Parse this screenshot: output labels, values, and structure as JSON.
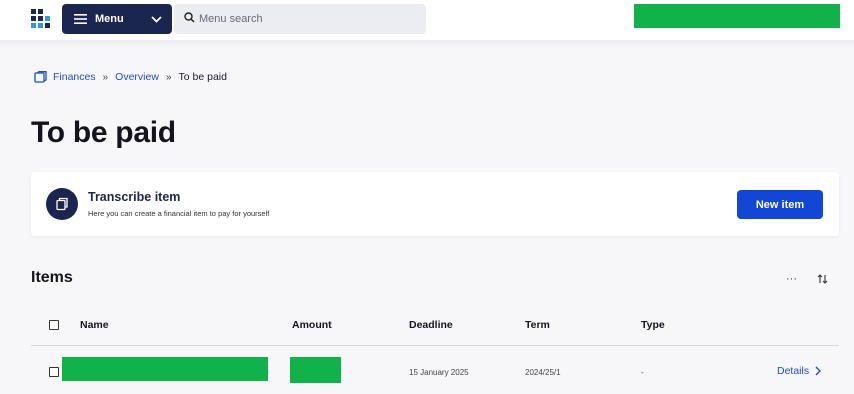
{
  "header": {
    "menu_label": "Menu",
    "search_placeholder": "Menu search",
    "logo_icon": "app-logo-icon",
    "user_redacted": true
  },
  "breadcrumb": {
    "items": [
      "Finances",
      "Overview"
    ],
    "current": "To be paid",
    "separator": "»"
  },
  "page": {
    "title": "To be paid"
  },
  "transcribe_card": {
    "title": "Transcribe item",
    "subtitle": "Here you can create a financial item to pay for yourself",
    "button_label": "New item",
    "icon": "document-icon"
  },
  "items": {
    "title": "Items",
    "more_label": "···",
    "columns": [
      "Name",
      "Amount",
      "Deadline",
      "Term",
      "Type"
    ],
    "rows": [
      {
        "name": "",
        "amount": "",
        "deadline": "15 January 2025",
        "term": "2024/25/1",
        "type": "-",
        "action": "Details"
      }
    ]
  },
  "colors": {
    "navy": "#1a2550",
    "primary": "#1246d6",
    "link": "#1c4fcc",
    "redaction": "#11b24a",
    "background": "#f7f7f9"
  }
}
